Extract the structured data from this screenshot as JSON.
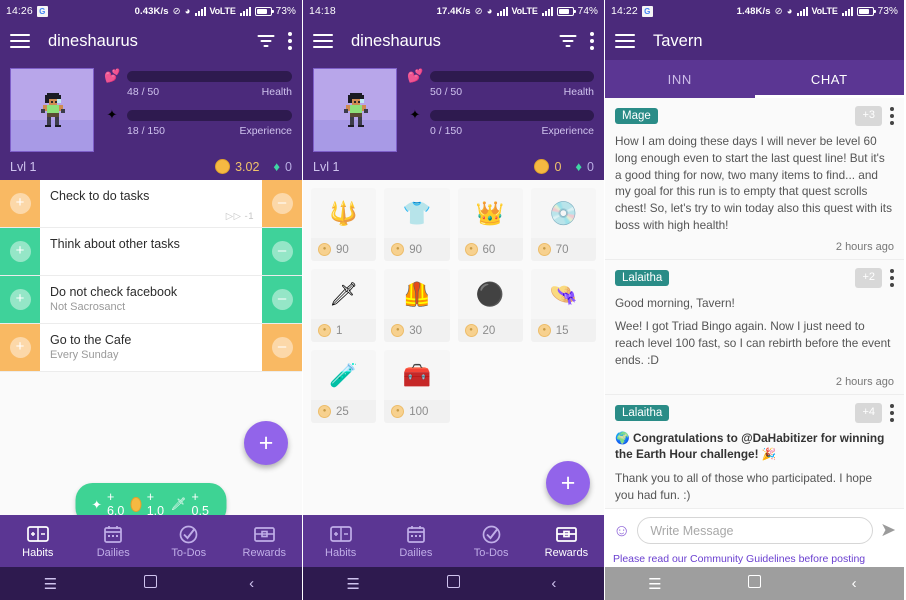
{
  "panel1": {
    "status": {
      "time": "14:26",
      "google_icon": "G",
      "speed": "0.43K/s",
      "dnd_icon": "dnd-icon",
      "wifi_icon": "wifi-icon",
      "volte": "VoLTE",
      "battery_pct": "73%"
    },
    "appbar": {
      "title": "dineshaurus",
      "menu_icon": "hamburger-icon",
      "filter_icon": "filter-icon",
      "overflow_icon": "kebab-icon"
    },
    "profile": {
      "health_value": "48 / 50",
      "health_label": "Health",
      "health_pct": 96,
      "exp_value": "18 / 150",
      "exp_label": "Experience",
      "exp_pct": 12,
      "level": "Lvl 1",
      "gold": "3.02",
      "gems": "0",
      "health_color": "#f7706e",
      "exp_color": "#fdc663"
    },
    "habits": [
      {
        "title": "Check to do tasks",
        "notes": "",
        "streak": "-1",
        "color": "orange",
        "plus": "+",
        "minus": "–"
      },
      {
        "title": "Think about other tasks",
        "notes": "",
        "streak": "",
        "color": "green",
        "plus": "+",
        "minus": "–"
      },
      {
        "title": "Do not check facebook",
        "notes": "Not Sacrosanct",
        "streak": "",
        "color": "green",
        "plus": "+",
        "minus": "–"
      },
      {
        "title": "Go to the Cafe",
        "notes": "Every Sunday",
        "streak": "",
        "color": "orange",
        "plus": "+",
        "minus": "–"
      }
    ],
    "fab_label": "+",
    "pill": {
      "exp": "+ 6.0",
      "gold": "+ 1.0",
      "damage": "+ 0.5",
      "color": "#3ed394"
    },
    "nav": [
      {
        "label": "Habits",
        "icon": "habits-icon",
        "active": true
      },
      {
        "label": "Dailies",
        "icon": "calendar-icon",
        "active": false
      },
      {
        "label": "To-Dos",
        "icon": "check-circle-icon",
        "active": false
      },
      {
        "label": "Rewards",
        "icon": "chest-icon",
        "active": false
      }
    ]
  },
  "panel2": {
    "status": {
      "time": "14:18",
      "speed": "17.4K/s",
      "volte": "VoLTE",
      "battery_pct": "74%"
    },
    "appbar": {
      "title": "dineshaurus"
    },
    "profile": {
      "health_value": "50 / 50",
      "health_label": "Health",
      "health_pct": 100,
      "exp_value": "0 / 150",
      "exp_label": "Experience",
      "exp_pct": 0,
      "level": "Lvl 1",
      "gold": "0",
      "gems": "0"
    },
    "rewards": [
      {
        "icon": "🔱",
        "price": "90",
        "name": "mace-reward"
      },
      {
        "icon": "👕",
        "price": "90",
        "name": "armor-reward"
      },
      {
        "icon": "👑",
        "price": "60",
        "name": "crown-reward"
      },
      {
        "icon": "💿",
        "price": "70",
        "name": "shield-reward"
      },
      {
        "icon": "🗡",
        "price": "1",
        "name": "sword-reward"
      },
      {
        "icon": "🦺",
        "price": "30",
        "name": "vest-reward"
      },
      {
        "icon": "⚫",
        "price": "20",
        "name": "buckler-reward"
      },
      {
        "icon": "👒",
        "price": "15",
        "name": "hat-reward"
      },
      {
        "icon": "🧪",
        "price": "25",
        "name": "potion-reward"
      },
      {
        "icon": "🧰",
        "price": "100",
        "name": "chest-reward"
      }
    ],
    "fab_label": "+",
    "nav": [
      {
        "label": "Habits",
        "active": false
      },
      {
        "label": "Dailies",
        "active": false
      },
      {
        "label": "To-Dos",
        "active": false
      },
      {
        "label": "Rewards",
        "active": true
      }
    ]
  },
  "panel3": {
    "status": {
      "time": "14:22",
      "speed": "1.48K/s",
      "volte": "VoLTE",
      "battery_pct": "73%"
    },
    "appbar": {
      "title": "Tavern"
    },
    "tabs": [
      {
        "label": "INN",
        "active": false
      },
      {
        "label": "CHAT",
        "active": true
      }
    ],
    "messages": [
      {
        "author": "Mage",
        "badge": "+3",
        "paragraphs": [
          "How I am doing these days I will never be level 60 long enough even to start the last quest line! But it's a good thing for now, two many items to find... and my goal for this run is to empty that quest scrolls chest! So, let's try to win today also this quest with its boss with high health!"
        ],
        "time": "2 hours ago",
        "badge_color": "#2a8c87"
      },
      {
        "author": "Lalaitha",
        "badge": "+2",
        "paragraphs": [
          "Good morning, Tavern!",
          "Wee! I got Triad Bingo again. Now I just need to reach level 100 fast, so I can rebirth before the event ends. :D"
        ],
        "time": "2 hours ago",
        "badge_color": "#2a8c87"
      },
      {
        "author": "Lalaitha",
        "badge": "+4",
        "paragraphs": [
          "🌍 Congratulations to @DaHabitizer for winning the Earth Hour challenge! 🎉",
          "Thank you to all of those who participated. I hope you had fun. :)"
        ],
        "time": "2 hours ago",
        "badge_color": "#2a8c87",
        "first_bold": true
      },
      {
        "author": "",
        "badge": "",
        "paragraphs": [],
        "time": "",
        "badge_color": "#c81414"
      }
    ],
    "composer": {
      "emoji_icon": "smiley-icon",
      "placeholder": "Write Message",
      "value": "",
      "send_icon": "send-icon"
    },
    "guidelines": "Please read our Community Guidelines before posting"
  },
  "sysnav": {
    "menu": "☰",
    "home": "home-square-icon",
    "back": "‹"
  }
}
